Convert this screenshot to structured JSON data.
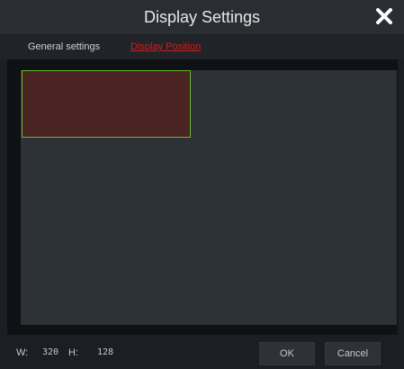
{
  "dialog": {
    "title": "Display Settings",
    "close_icon": "close-icon"
  },
  "tabs": [
    {
      "label": "General settings",
      "active": false
    },
    {
      "label": "Display Position",
      "active": true
    }
  ],
  "footer": {
    "width_label": "W:",
    "width_value": "320",
    "height_label": "H:",
    "height_value": "128",
    "ok_label": "OK",
    "cancel_label": "Cancel"
  },
  "colors": {
    "active_tab": "#d21e1e",
    "region_fill": "#4a2323",
    "region_border": "#67b82d"
  }
}
